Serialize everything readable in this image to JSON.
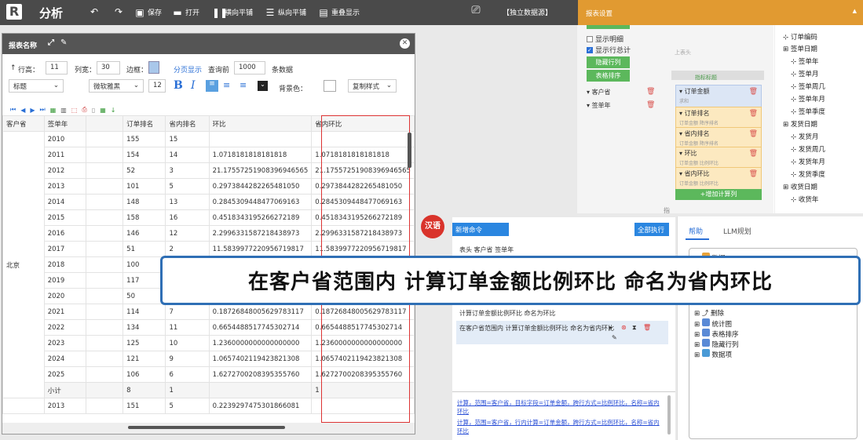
{
  "toolbar": {
    "title": "分析",
    "save": "保存",
    "open": "打开",
    "hsplit": "横向平铺",
    "vsplit": "纵向平铺",
    "overlay": "重叠显示",
    "datasource": "【独立数据源】",
    "settings": "报表设置"
  },
  "rightpanel": {
    "show_detail": "显示明细",
    "show_total": "显示行总计",
    "hide_col": "隐藏行列",
    "table_sort": "表格排序",
    "header_label": "上表头",
    "metric_label": "指标标题",
    "dims": [
      "客户省",
      "签单年"
    ],
    "metrics": [
      {
        "name": "订单金额",
        "sub": "求和"
      },
      {
        "name": "订单排名",
        "sub": "订单金额 降序排名"
      },
      {
        "name": "省内排名",
        "sub": "订单金额 降序排名"
      },
      {
        "name": "环比",
        "sub": "订单金额 比例环比"
      },
      {
        "name": "省内环比",
        "sub": "订单金额 比例环比"
      }
    ],
    "add_calc": "+增加计算列",
    "bottom_char": "指"
  },
  "tree": {
    "items": [
      "订单编码",
      "签单日期",
      "签单年",
      "签单月",
      "签单周几",
      "签单年月",
      "签单季度",
      "发货日期",
      "发货月",
      "发货周几",
      "发货年月",
      "发货季度",
      "收货日期",
      "收货年"
    ]
  },
  "report": {
    "title": "报表名称",
    "row_height_label": "行高：",
    "row_height": "11",
    "col_width_label": "列宽：",
    "col_width": "30",
    "border_label": "边框：",
    "paging": "分页显示",
    "query_label": "查询前",
    "query_count": "1000",
    "rows_label": "条数据",
    "style": "标题",
    "font": "微软雅黑",
    "font_size": "12",
    "bold": "B",
    "italic": "I",
    "bg_label": "背景色：",
    "copy_style": "复制样式",
    "columns": [
      "客户省",
      "签单年",
      "",
      "订单排名",
      "省内排名",
      "环比",
      "省内环比"
    ],
    "province": "北京",
    "rows": [
      [
        "2010",
        "155",
        "15",
        "",
        ""
      ],
      [
        "2011",
        "154",
        "14",
        "1.0718181818181818",
        "1.0718181818181818"
      ],
      [
        "2012",
        "52",
        "3",
        "21.17557251908396946565",
        "21.17557251908396946565"
      ],
      [
        "2013",
        "101",
        "5",
        "0.2973844282265481050",
        "0.2973844282265481050"
      ],
      [
        "2014",
        "148",
        "13",
        "0.2845309448477069163",
        "0.2845309448477069163"
      ],
      [
        "2015",
        "158",
        "16",
        "0.4518343195266272189",
        "0.4518343195266272189"
      ],
      [
        "2016",
        "146",
        "12",
        "2.2996331587218438973",
        "2.2996331587218438973"
      ],
      [
        "2017",
        "51",
        "2",
        "11.5839977220956719817",
        "11.5839977220956719817"
      ],
      [
        "2018",
        "100",
        "",
        "",
        ""
      ],
      [
        "2019",
        "117",
        "",
        "",
        ""
      ],
      [
        "2020",
        "50",
        "",
        "",
        ""
      ],
      [
        "2021",
        "114",
        "7",
        "0.18726848005629783117",
        "0.18726848005629783117"
      ],
      [
        "2022",
        "134",
        "11",
        "0.6654488517745302714",
        "0.6654488517745302714"
      ],
      [
        "2023",
        "125",
        "10",
        "1.2360000000000000000",
        "1.2360000000000000000"
      ],
      [
        "2024",
        "121",
        "9",
        "1.0657402119423821308",
        "1.0657402119423821308"
      ],
      [
        "2025",
        "106",
        "6",
        "1.6272700208395355760",
        "1.6272700208395355760"
      ],
      [
        "小计",
        "8",
        "1",
        "",
        "1"
      ],
      [
        "2013",
        "151",
        "5",
        "0.2239297475301866081",
        ""
      ]
    ]
  },
  "cmd": {
    "lang": "汉语",
    "new_cmd": "新增命令",
    "run_all": "全部执行",
    "line1": "表头 客户省 签单年",
    "line2": "计算订单金额比例环比 命名为环比",
    "line3": "在客户省范围内 计算订单金额比例环比 命名为省内环比",
    "log1": "计算，范围=客户省，目标字段=订单金额，跨行方式=比例环比，名称=省内环比",
    "log2": "计算，范围=客户省，行内计算=订单金额，跨行方式=比例环比，名称=省内环比"
  },
  "help": {
    "tab1": "帮助",
    "tab2": "LLM规划",
    "items": [
      "数据",
      "删除",
      "统计图",
      "表格排序",
      "隐藏行列",
      "数据项"
    ]
  },
  "tooltip": {
    "text": "在客户省范围内 计算订单金额比例环比 命名为省内环比"
  }
}
